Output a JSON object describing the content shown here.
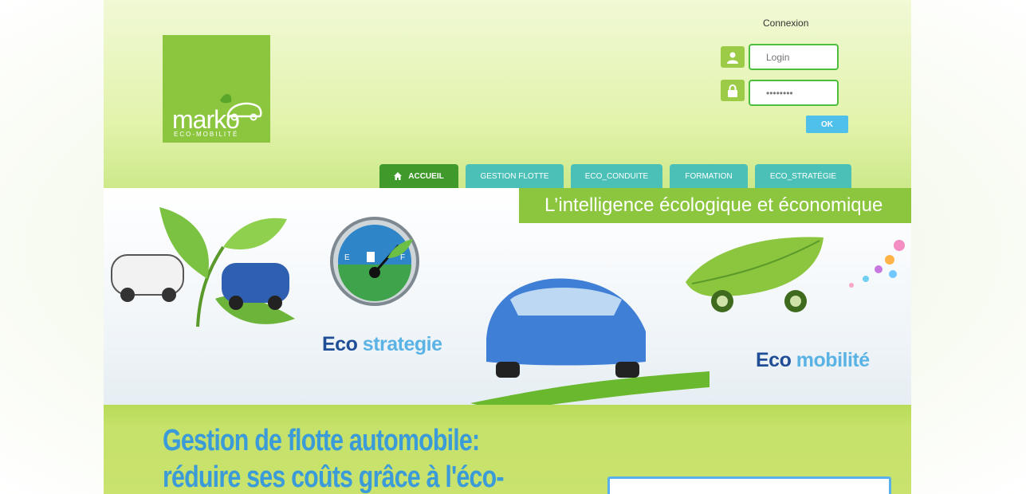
{
  "logo": {
    "word": "marko",
    "tagline": "ECO-MOBILITÉ"
  },
  "login": {
    "title": "Connexion",
    "login_placeholder": "Login",
    "password_value": "••••••••",
    "ok_label": "OK"
  },
  "nav": {
    "items": [
      {
        "label": "ACCUEIL"
      },
      {
        "label": "GESTION FLOTTE"
      },
      {
        "label": "ECO_CONDUITE"
      },
      {
        "label": "FORMATION"
      },
      {
        "label": "ECO_STRATÉGIE"
      }
    ]
  },
  "banner": {
    "headline": "L’intelligence écologique et économique",
    "eco_strategie": {
      "a": "Eco ",
      "b": "strategie"
    },
    "eco_mobilite": {
      "a": "Eco ",
      "b": "mobilité"
    },
    "gauge_e": "E",
    "gauge_f": "F"
  },
  "main": {
    "headline": "Gestion de flotte automobile: réduire ses coûts grâce à l'éco-"
  },
  "colors": {
    "brand_green": "#8cc63f",
    "active_tab": "#3f9a2b",
    "tab": "#4bc0b7",
    "headline_blue": "#3b9ad8",
    "ok_button": "#4fc0ea"
  }
}
